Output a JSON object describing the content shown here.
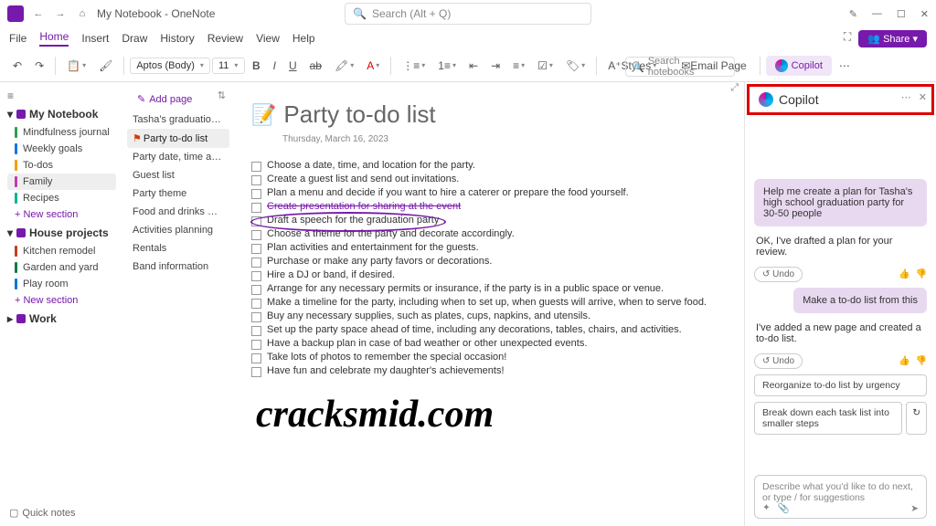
{
  "titlebar": {
    "title": "My Notebook - OneNote",
    "search_placeholder": "Search (Alt + Q)"
  },
  "menubar": [
    "File",
    "Home",
    "Insert",
    "Draw",
    "History",
    "Review",
    "View",
    "Help"
  ],
  "share_label": "Share",
  "ribbon": {
    "font_name": "Aptos (Body)",
    "font_size": "11",
    "styles_label": "Styles",
    "email_label": "Email Page",
    "copilot_label": "Copilot"
  },
  "sidebar": {
    "notebooks": [
      {
        "name": "My Notebook",
        "expanded": true,
        "sections": [
          {
            "name": "Mindfulness journal",
            "color": "#2e9e4f"
          },
          {
            "name": "Weekly goals",
            "color": "#1a73e8"
          },
          {
            "name": "To-dos",
            "color": "#f2a100"
          },
          {
            "name": "Family",
            "color": "#c239b3",
            "active": true
          },
          {
            "name": "Recipes",
            "color": "#00b294"
          }
        ]
      },
      {
        "name": "House projects",
        "expanded": true,
        "sections": [
          {
            "name": "Kitchen remodel",
            "color": "#c43e1c"
          },
          {
            "name": "Garden and yard",
            "color": "#107c41"
          },
          {
            "name": "Play room",
            "color": "#0078d4"
          }
        ]
      },
      {
        "name": "Work",
        "expanded": false,
        "sections": []
      }
    ],
    "new_section": "New section",
    "quick_notes": "Quick notes"
  },
  "pages": {
    "add_page": "Add page",
    "items": [
      {
        "label": "Tasha's graduation par..."
      },
      {
        "label": "Party to-do list",
        "active": true,
        "flagged": true
      },
      {
        "label": "Party date, time and locat..."
      },
      {
        "label": "Guest list"
      },
      {
        "label": "Party theme"
      },
      {
        "label": "Food and drinks menu"
      },
      {
        "label": "Activities planning"
      },
      {
        "label": "Rentals"
      },
      {
        "label": "Band information"
      }
    ]
  },
  "content": {
    "search_placeholder": "Search notebooks",
    "page_title": "Party to-do list",
    "page_date": "Thursday, March 16, 2023",
    "todos": [
      "Choose a date, time, and location for the party.",
      "Create a guest list and send out invitations.",
      "Plan a menu and decide if you want to hire a caterer or prepare the food yourself.",
      "Create presentation for sharing at the event",
      "Draft a speech for the graduation party",
      "Choose a theme for the party and decorate accordingly.",
      "Plan activities and entertainment for the guests.",
      "Purchase or make any party favors or decorations.",
      "Hire a DJ or band, if desired.",
      "Arrange for any necessary permits or insurance, if the party is in a public space or venue.",
      "Make a timeline for the party, including when to set up, when guests will arrive, when to serve food.",
      "Buy any necessary supplies, such as plates, cups, napkins, and utensils.",
      "Set up the party space ahead of time, including any decorations, tables, chairs, and activities.",
      "Have a backup plan in case of bad weather or other unexpected events.",
      "Take lots of photos to remember the special occasion!",
      "Have fun and celebrate my daughter's achievements!"
    ]
  },
  "copilot": {
    "title": "Copilot",
    "user_msg_1": "Help me create a plan for Tasha's high school graduation party for 30-50 people",
    "ai_msg_1": "OK, I've drafted a plan for your review.",
    "undo": "Undo",
    "user_msg_2": "Make a to-do list from this",
    "ai_msg_2": "I've added a new page and created a to-do list.",
    "suggestions": [
      "Reorganize to-do list by urgency",
      "Break down each task list into smaller steps"
    ],
    "input_placeholder": "Describe what you'd like to do next, or type / for suggestions"
  },
  "watermark": "cracksmid.com"
}
